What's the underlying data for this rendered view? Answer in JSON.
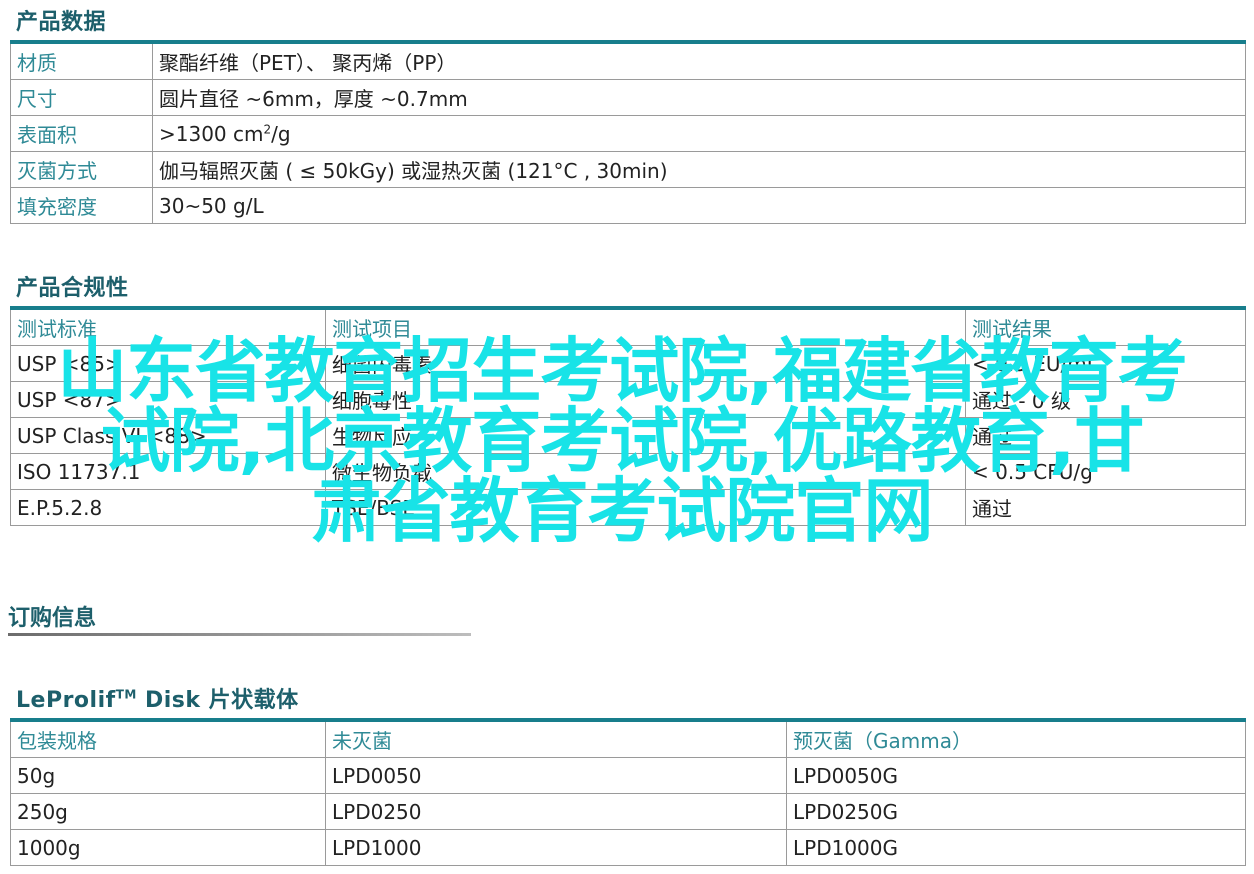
{
  "product_data": {
    "title": "产品数据",
    "rows": [
      {
        "label": "材质",
        "value": "聚酯纤维（PET）、 聚丙烯（PP）"
      },
      {
        "label": "尺寸",
        "value": "圆片直径 ~6mm，厚度 ~0.7mm"
      },
      {
        "label": "表面积",
        "value_pre": ">1300 cm",
        "value_sup": "2",
        "value_post": "/g"
      },
      {
        "label": "灭菌方式",
        "value": "伽马辐照灭菌 ( ≤ 50kGy) 或湿热灭菌 (121°C , 30min)"
      },
      {
        "label": "填充密度",
        "value": "30~50 g/L"
      }
    ]
  },
  "compliance": {
    "title": "产品合规性",
    "headers": [
      "测试标准",
      "测试项目",
      "测试结果"
    ],
    "rows": [
      [
        "USP <85>",
        "细菌内毒素",
        "< 0.5 EU/mL"
      ],
      [
        "USP <87>",
        "细胞毒性",
        "通过 - 0 级"
      ],
      [
        "USP Class VI <88>",
        "生物反应",
        "通过"
      ],
      [
        "ISO 11737.1",
        "微生物负载",
        "< 0.5 CFU/g"
      ],
      [
        "E.P.5.2.8",
        "TSE/BSE",
        "通过"
      ]
    ]
  },
  "ordering": {
    "title": "订购信息"
  },
  "leprolif": {
    "title_pre": "LeProlif",
    "title_tm": "TM",
    "title_post": " Disk 片状载体",
    "headers": [
      "包装规格",
      "未灭菌",
      "预灭菌（Gamma）"
    ],
    "rows": [
      [
        "50g",
        "LPD0050",
        "LPD0050G"
      ],
      [
        "250g",
        "LPD0250",
        "LPD0250G"
      ],
      [
        "1000g",
        "LPD1000",
        "LPD1000G"
      ]
    ]
  },
  "watermark": {
    "line1": "山东省教育招生考试院,福建省教育考",
    "line2": "试院,北京教育考试院,优路教育,甘",
    "line3": "肃省教育考试院官网",
    "color": "#18e3e7"
  },
  "colors": {
    "accent": "#187e8c",
    "label_text": "#2f8a96",
    "heading_text": "#1d5f6b"
  }
}
